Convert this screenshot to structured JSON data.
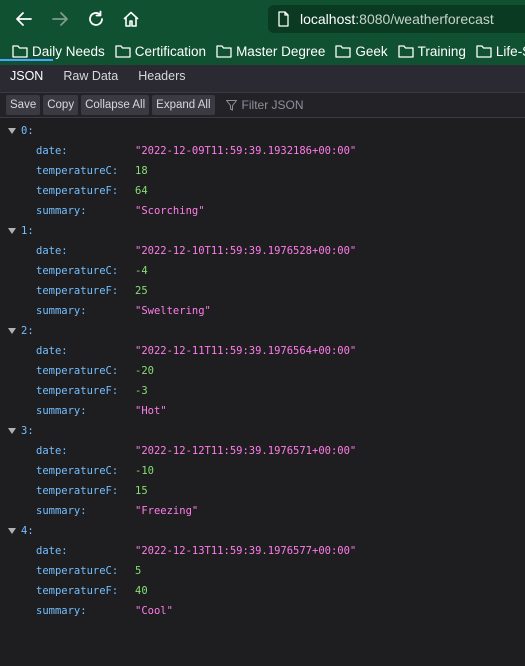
{
  "address_bar": {
    "host": "localhost",
    "rest": ":8080/weatherforecast"
  },
  "bookmarks": [
    {
      "label": "Daily Needs"
    },
    {
      "label": "Certification"
    },
    {
      "label": "Master Degree"
    },
    {
      "label": "Geek"
    },
    {
      "label": "Training"
    },
    {
      "label": "Life-Study"
    }
  ],
  "tabs": [
    {
      "label": "JSON",
      "active": true
    },
    {
      "label": "Raw Data",
      "active": false
    },
    {
      "label": "Headers",
      "active": false
    }
  ],
  "toolbar": {
    "save": "Save",
    "copy": "Copy",
    "collapse_all": "Collapse All",
    "expand_all": "Expand All",
    "filter_placeholder": "Filter JSON"
  },
  "items": [
    {
      "index": "0:",
      "date": "\"2022-12-09T11:59:39.1932186+00:00\"",
      "temperatureC": "18",
      "temperatureF": "64",
      "summary": "\"Scorching\""
    },
    {
      "index": "1:",
      "date": "\"2022-12-10T11:59:39.1976528+00:00\"",
      "temperatureC": "-4",
      "temperatureF": "25",
      "summary": "\"Sweltering\""
    },
    {
      "index": "2:",
      "date": "\"2022-12-11T11:59:39.1976564+00:00\"",
      "temperatureC": "-20",
      "temperatureF": "-3",
      "summary": "\"Hot\""
    },
    {
      "index": "3:",
      "date": "\"2022-12-12T11:59:39.1976571+00:00\"",
      "temperatureC": "-10",
      "temperatureF": "15",
      "summary": "\"Freezing\""
    },
    {
      "index": "4:",
      "date": "\"2022-12-13T11:59:39.1976577+00:00\"",
      "temperatureC": "5",
      "temperatureF": "40",
      "summary": "\"Cool\""
    }
  ],
  "keys": {
    "date": "date:",
    "temperatureC": "temperatureC:",
    "temperatureF": "temperatureF:",
    "summary": "summary:"
  }
}
